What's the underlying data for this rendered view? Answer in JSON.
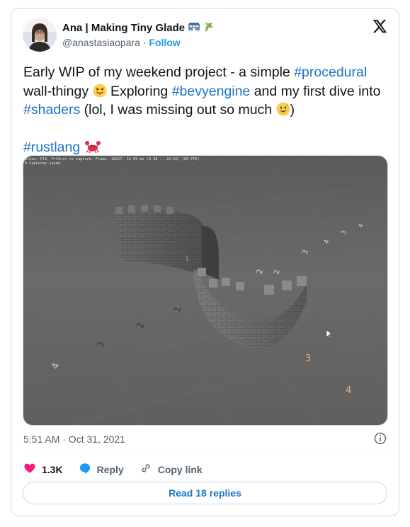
{
  "author": {
    "name": "Ana | Making Tiny Glade",
    "handle": "@anastasiaopara",
    "separator": "·",
    "follow_label": "Follow",
    "name_emojis": [
      "hotel-icon",
      "herb-icon"
    ]
  },
  "tweet": {
    "text_1": "Early WIP of my weekend project - a simple ",
    "tag_procedural": "#procedural",
    "text_2": " wall-thingy ",
    "text_3": " Exploring  ",
    "tag_bevyengine": "#bevyengine",
    "text_4": " and my first dive into ",
    "tag_shaders": "#shaders",
    "text_5": " (lol, I was missing out so much ",
    "text_6": ")",
    "tag_rustlang": "#rustlang"
  },
  "media": {
    "overlay_line1": "ulkan. F12, PrtScrn to capture. Frame: 18227. 16.69 ms (0.38 .. 24.56) (60 FPS)",
    "overlay_line2": "0 Captures saved.",
    "floor_numbers": [
      "1",
      "2",
      "3",
      "4",
      "3",
      "4",
      "2",
      "3",
      "4",
      "1",
      "2",
      "3",
      "4"
    ]
  },
  "meta": {
    "timestamp": "5:51 AM · Oct 31, 2021"
  },
  "actions": {
    "likes_count": "1.3K",
    "reply_label": "Reply",
    "copy_link_label": "Copy link",
    "read_replies_label": "Read 18 replies"
  },
  "colors": {
    "link": "#1d74c7",
    "like": "#f91880",
    "reply": "#1d9bf0",
    "muted": "#536471"
  }
}
